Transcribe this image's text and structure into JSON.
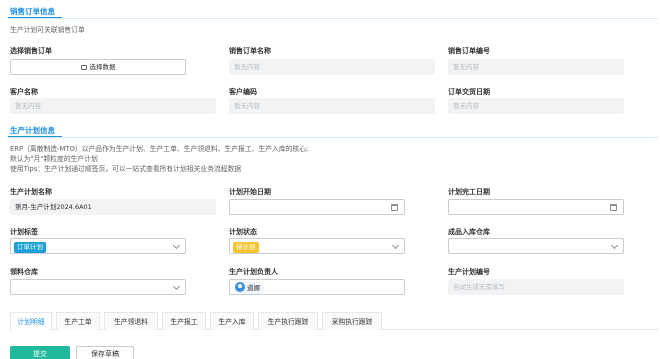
{
  "sales_section": {
    "title": "销售订单信息",
    "description": "生产计划可关联销售订单",
    "select_order_label": "选择销售订单",
    "choose_button": "选择数据",
    "order_name_label": "销售订单名称",
    "order_name_value": "暂无内容",
    "order_no_label": "销售订单编号",
    "order_no_value": "暂无内容",
    "customer_name_label": "客户名称",
    "customer_name_value": "暂无内容",
    "customer_code_label": "客户编码",
    "customer_code_value": "暂无内容",
    "delivery_date_label": "订单交货日期",
    "delivery_date_value": "暂无内容"
  },
  "plan_section": {
    "title": "生产计划信息",
    "desc_lines": [
      "ERP（离散制造-MTO）以产品作为生产计划、生产工单、生产领退料、生产报工、生产入库的核心;",
      "默认为\"月\"颗粒度的生产计划",
      "使用Tips：生产计划通过顺签页，可以一站式查看所有计划相关业务流程数据"
    ],
    "plan_name_label": "生产计划名称",
    "plan_name_value": "第月-生产计划2024.6A01",
    "start_date_label": "计划开始日期",
    "end_date_label": "计划完工日期",
    "tag_label": "计划标签",
    "tag_value": "订单计划",
    "status_label": "计划状态",
    "status_value": "待计划",
    "warehouse_label": "成品入库仓库",
    "pick_warehouse_label": "领料仓库",
    "owner_label": "生产计划负责人",
    "owner_value": "道娜",
    "plan_no_label": "生产计划编号",
    "plan_no_placeholder": "自动生成无需填写"
  },
  "tabs": [
    "计划明细",
    "生产工单",
    "生产领退料",
    "生产报工",
    "生产入库",
    "生产执行跟踪",
    "采购执行跟踪"
  ],
  "actions": {
    "submit": "提交",
    "save_draft": "保存草稿"
  },
  "colors": {
    "accent": "#1f8fe0",
    "submit": "#1fb99b",
    "tag_blue": "#1aa0d6",
    "tag_yellow": "#f3c532"
  }
}
